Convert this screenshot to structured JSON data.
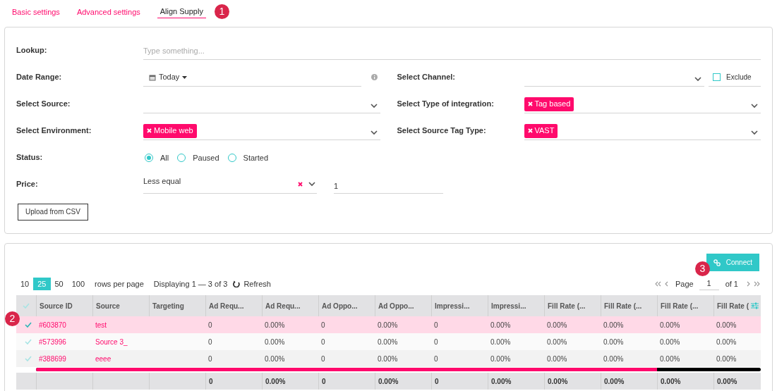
{
  "tabs": [
    {
      "label": "Basic settings",
      "selected": false
    },
    {
      "label": "Advanced settings",
      "selected": false
    },
    {
      "label": "Align Supply",
      "selected": true
    }
  ],
  "callouts": [
    "1",
    "2",
    "3"
  ],
  "form": {
    "lookup": {
      "label": "Lookup:",
      "placeholder": "Type something..."
    },
    "rows": [
      {
        "left": {
          "kind": "date",
          "label": "Date Range:",
          "value": "Today"
        },
        "right": {
          "kind": "select",
          "label": "Select Channel:",
          "exclude": {
            "label": "Exclude",
            "checked": false
          }
        }
      },
      {
        "left": {
          "kind": "select",
          "label": "Select Source:"
        },
        "right": {
          "kind": "select",
          "label": "Select Type of integration:",
          "tags": [
            "Tag based"
          ]
        }
      },
      {
        "left": {
          "kind": "select",
          "label": "Select Environment:",
          "tags": [
            "Mobile web"
          ]
        },
        "right": {
          "kind": "select",
          "label": "Select Source Tag Type:",
          "tags": [
            "VAST"
          ]
        }
      },
      {
        "left": {
          "kind": "radio",
          "label": "Status:",
          "options": [
            {
              "label": "All",
              "selected": true
            },
            {
              "label": "Paused",
              "selected": false
            },
            {
              "label": "Started",
              "selected": false
            }
          ]
        }
      },
      {
        "left": {
          "kind": "price",
          "label": "Price:",
          "operator": "Less equal",
          "value": "1"
        }
      }
    ],
    "upload_button": "Upload from CSV"
  },
  "grid": {
    "connect_button": "Connect",
    "page_sizes": [
      {
        "label": "10",
        "selected": false
      },
      {
        "label": "25",
        "selected": true
      },
      {
        "label": "50",
        "selected": false
      },
      {
        "label": "100",
        "selected": false
      }
    ],
    "rows_per_page": "rows per page",
    "displaying": "Displaying 1 — 3 of 3",
    "refresh": "Refresh",
    "pager": {
      "label": "Page",
      "page": "1",
      "of": "of 1"
    },
    "columns": [
      "Source ID",
      "Source",
      "Targeting",
      "Ad Requ...",
      "Ad Requ...",
      "Ad Oppo...",
      "Ad Oppo...",
      "Impressi...",
      "Impressi...",
      "Fill Rate (...",
      "Fill Rate (...",
      "Fill Rate (...",
      "Fill Rate ("
    ],
    "rows": [
      {
        "selected": true,
        "cells": [
          "#603870",
          "test",
          null,
          "0",
          "0.00%",
          "0",
          "0.00%",
          "0",
          "0.00%",
          "0.00%",
          "0.00%",
          "0.00%",
          "0.00%"
        ]
      },
      {
        "selected": false,
        "cells": [
          "#573996",
          "Source 3_",
          null,
          "0",
          "0.00%",
          "0",
          "0.00%",
          "0",
          "0.00%",
          "0.00%",
          "0.00%",
          "0.00%",
          "0.00%"
        ]
      },
      {
        "selected": false,
        "cells": [
          "#388699",
          "eeee",
          null,
          "0",
          "0.00%",
          "0",
          "0.00%",
          "0",
          "0.00%",
          "0.00%",
          "0.00%",
          "0.00%",
          "0.00%"
        ]
      }
    ],
    "totals": [
      "0",
      "0.00%",
      "0",
      "0.00%",
      "0",
      "0.00%",
      "0.00%",
      "0.00%",
      "0.00%",
      "0.00%"
    ]
  }
}
